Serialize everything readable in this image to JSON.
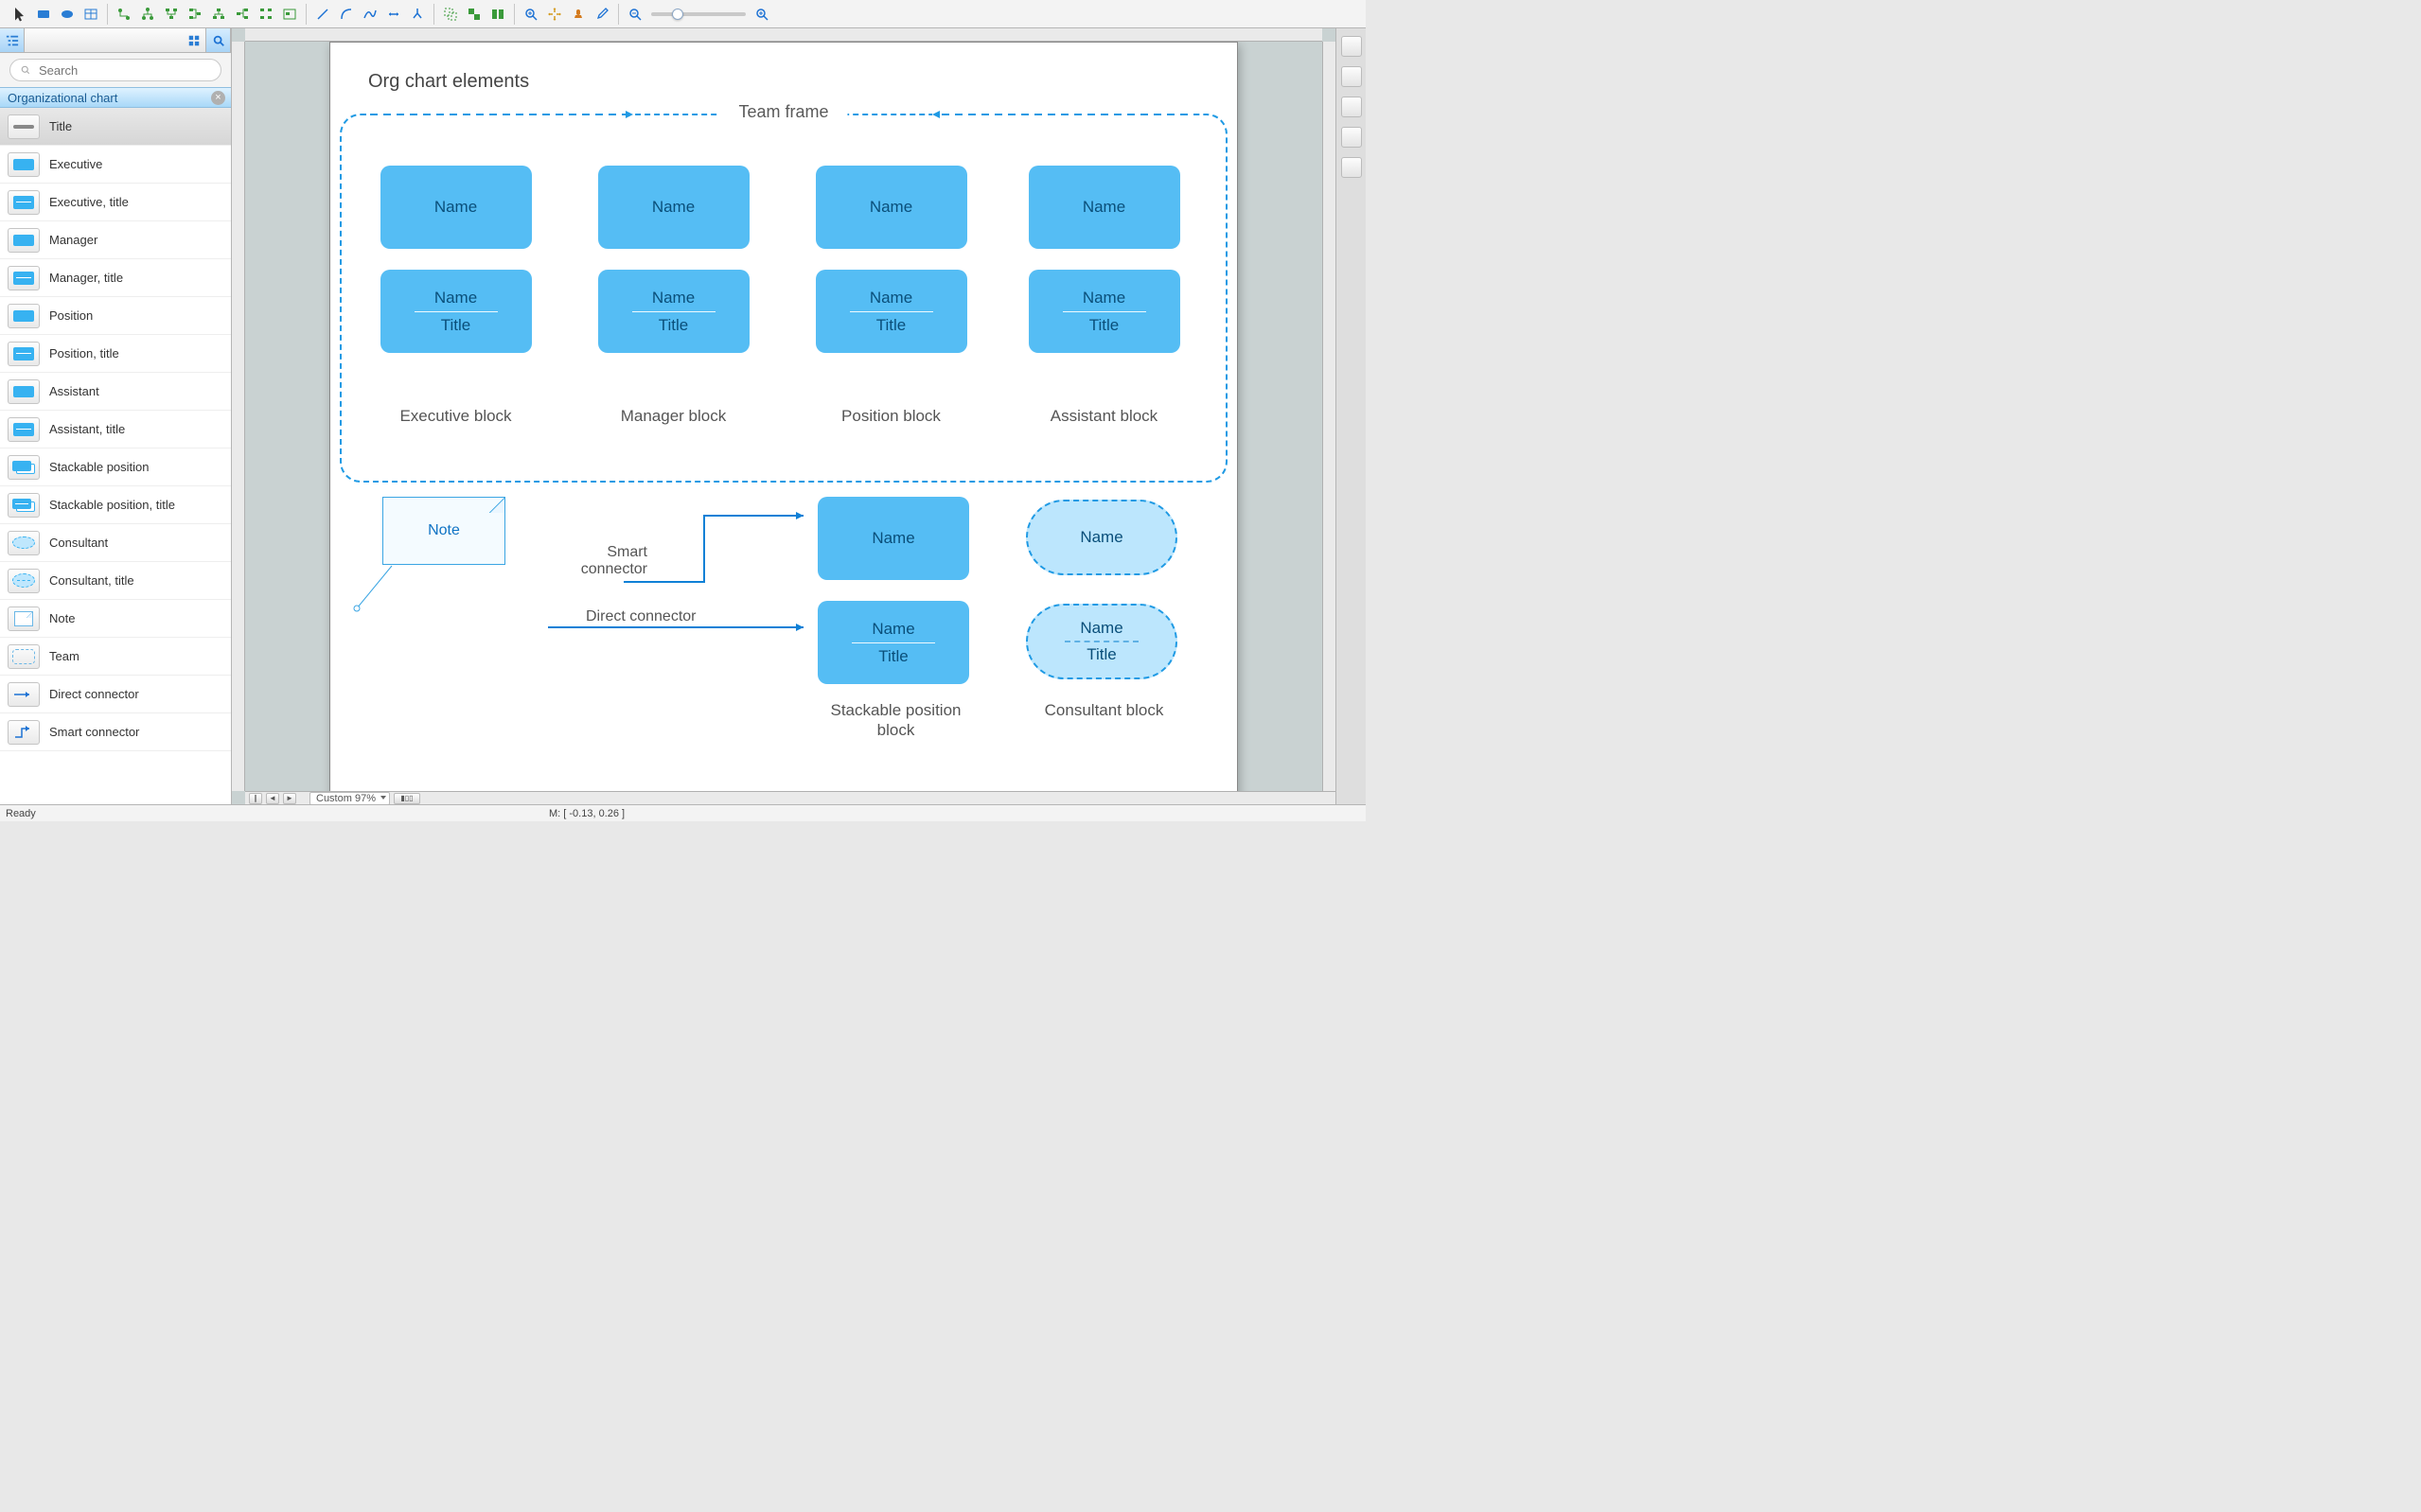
{
  "search": {
    "placeholder": "Search"
  },
  "section": {
    "title": "Organizational chart"
  },
  "shapes": [
    {
      "label": "Title",
      "sel": true,
      "thumb": "bar"
    },
    {
      "label": "Executive",
      "thumb": "rect"
    },
    {
      "label": "Executive, title",
      "thumb": "rect2"
    },
    {
      "label": "Manager",
      "thumb": "rect"
    },
    {
      "label": "Manager, title",
      "thumb": "rect2"
    },
    {
      "label": "Position",
      "thumb": "rect"
    },
    {
      "label": "Position, title",
      "thumb": "rect2"
    },
    {
      "label": "Assistant",
      "thumb": "rect"
    },
    {
      "label": "Assistant, title",
      "thumb": "rect2"
    },
    {
      "label": "Stackable position",
      "thumb": "stack"
    },
    {
      "label": "Stackable position, title",
      "thumb": "stack2"
    },
    {
      "label": "Consultant",
      "thumb": "ellipse"
    },
    {
      "label": "Consultant, title",
      "thumb": "ellipse2"
    },
    {
      "label": "Note",
      "thumb": "note"
    },
    {
      "label": "Team",
      "thumb": "team"
    },
    {
      "label": "Direct connector",
      "thumb": "dconn"
    },
    {
      "label": "Smart connector",
      "thumb": "sconn"
    }
  ],
  "page": {
    "title": "Org chart elements",
    "team_frame_label": "Team frame",
    "name_text": "Name",
    "title_text": "Title",
    "col_labels": [
      "Executive block",
      "Manager block",
      "Position block",
      "Assistant block"
    ],
    "note_text": "Note",
    "smart_connector_label": "Smart connector",
    "direct_connector_label": "Direct connector",
    "stackable_label": "Stackable position block",
    "consultant_label": "Consultant block"
  },
  "footer": {
    "zoom_label": "Custom 97%"
  },
  "status": {
    "ready": "Ready",
    "mouse": "M: [ -0.13, 0.26 ]"
  }
}
